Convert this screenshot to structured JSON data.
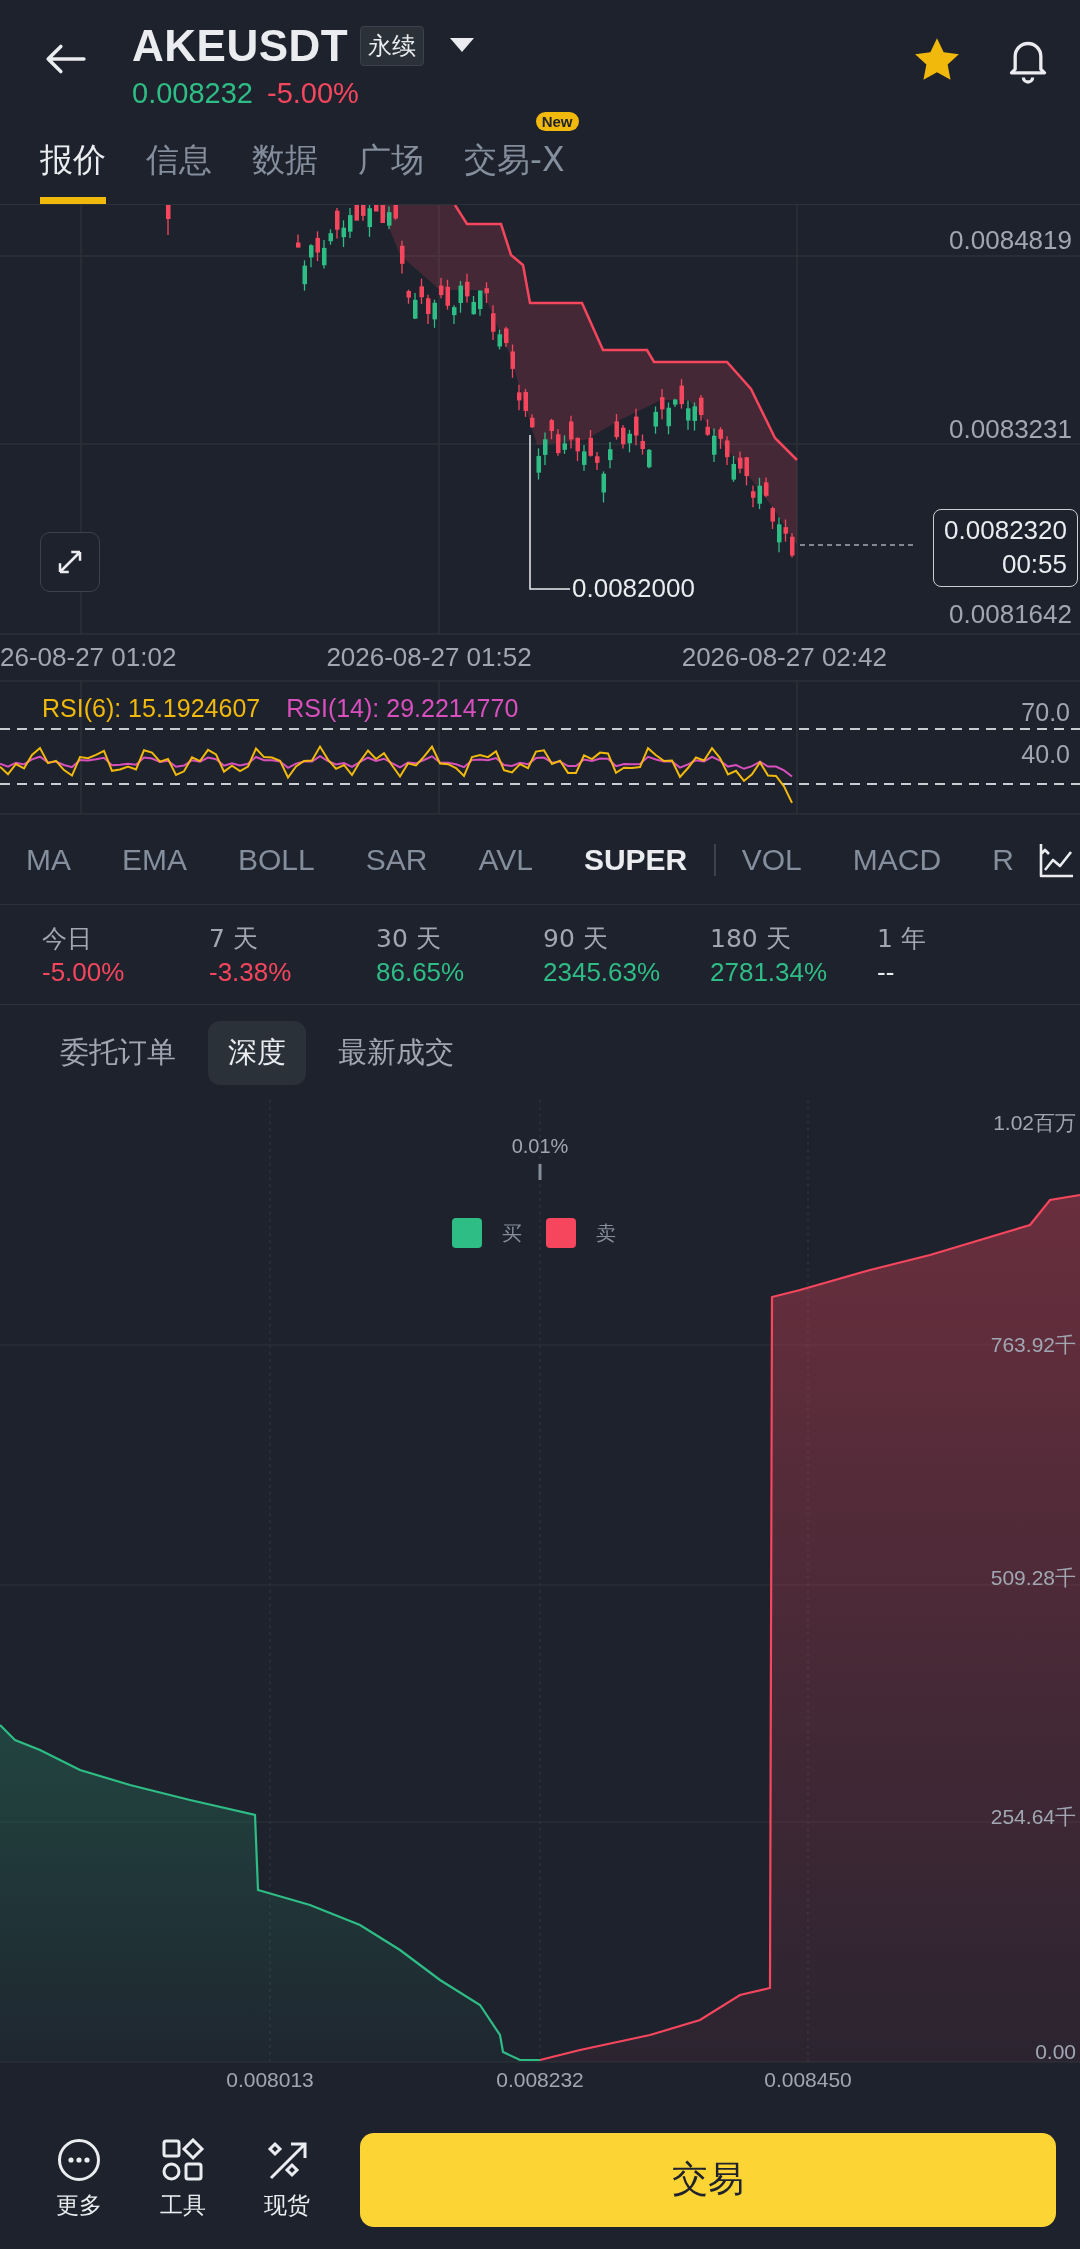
{
  "header": {
    "symbol": "AKEUSDT",
    "badge": "永续",
    "price": "0.008232",
    "change": "-5.00%"
  },
  "tabs": [
    {
      "label": "报价",
      "selected": true
    },
    {
      "label": "信息",
      "selected": false
    },
    {
      "label": "数据",
      "selected": false
    },
    {
      "label": "广场",
      "selected": false
    },
    {
      "label": "交易-X",
      "selected": false,
      "badge": "New"
    }
  ],
  "price_chart": {
    "y_labels": [
      "0.0084819",
      "0.0083231",
      "0.0081642"
    ],
    "low_label": "0.0082000",
    "current_price": "0.0082320",
    "countdown": "00:55",
    "time_labels": [
      "26-08-27 01:02",
      "2026-08-27 01:52",
      "2026-08-27 02:42"
    ]
  },
  "rsi": {
    "labels": [
      "RSI(6): 15.1924607",
      "RSI(14): 29.2214770"
    ],
    "levels": [
      "70.0",
      "40.0"
    ]
  },
  "indicators": [
    {
      "label": "MA",
      "selected": false
    },
    {
      "label": "EMA",
      "selected": false
    },
    {
      "label": "BOLL",
      "selected": false
    },
    {
      "label": "SAR",
      "selected": false
    },
    {
      "label": "AVL",
      "selected": false
    },
    {
      "label": "SUPER",
      "selected": true
    },
    {
      "label": "VOL",
      "selected": false
    },
    {
      "label": "MACD",
      "selected": false
    },
    {
      "label": "R",
      "selected": false
    }
  ],
  "stats": [
    {
      "label": "今日",
      "value": "-5.00%",
      "color": "#f6465d"
    },
    {
      "label": "7 天",
      "value": "-3.38%",
      "color": "#f6465d"
    },
    {
      "label": "30 天",
      "value": "86.65%",
      "color": "#2ebd85"
    },
    {
      "label": "90 天",
      "value": "2345.63%",
      "color": "#2ebd85"
    },
    {
      "label": "180 天",
      "value": "2781.34%",
      "color": "#2ebd85"
    },
    {
      "label": "1 年",
      "value": "--",
      "color": "#eaecef"
    }
  ],
  "book_tabs": [
    {
      "label": "委托订单",
      "selected": false
    },
    {
      "label": "深度",
      "selected": true
    },
    {
      "label": "最新成交",
      "selected": false
    }
  ],
  "depth_chart": {
    "spread": "0.01%",
    "legend": [
      {
        "label": "买",
        "color": "#2ebd85"
      },
      {
        "label": "卖",
        "color": "#f6465d"
      }
    ],
    "y_labels": [
      "1.02百万",
      "763.92千",
      "509.28千",
      "254.64千",
      "0.00"
    ],
    "x_labels": [
      "0.008013",
      "0.008232",
      "0.008450"
    ]
  },
  "actions": [
    {
      "label": "更多",
      "kind": "more"
    },
    {
      "label": "工具",
      "kind": "tools"
    },
    {
      "label": "现货",
      "kind": "spot"
    }
  ],
  "trade_button": "交易"
}
